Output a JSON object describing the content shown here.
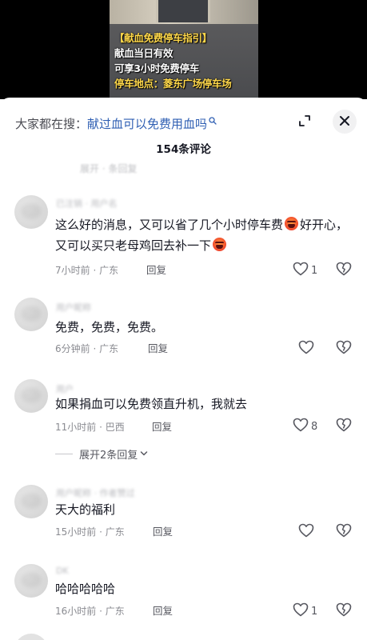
{
  "video": {
    "caption_lines": [
      "【献血免费停车指引】",
      "献血当日有效",
      "可享3小时免费停车",
      "停车地点：菱东广场停车场"
    ]
  },
  "sheet": {
    "search_prefix": "大家都在搜：",
    "search_term": "献过血可以免费用血吗",
    "comment_count": "154条评论",
    "icons": {
      "search": "search-icon",
      "expand": "expand-icon",
      "close": "close-icon",
      "like": "heart-icon",
      "dislike": "broken-heart-icon",
      "chevron": "chevron-down-icon"
    }
  },
  "ghost_reply": "展开 · 条回复",
  "comments": [
    {
      "username": "已注销 · 用户名",
      "text_parts": [
        "这么好的消息，又可以省了几个小时停车费",
        "好开心，又可以买只老母鸡回去补一下",
        ""
      ],
      "time": "7小时前 · 广东",
      "reply": "回复",
      "likes": "1"
    },
    {
      "username": "用户昵称",
      "text_parts": [
        "免费，免费，免费。"
      ],
      "time": "6分钟前 · 广东",
      "reply": "回复",
      "likes": ""
    },
    {
      "username": "用户",
      "text_parts": [
        "如果捐血可以免费领直升机，我就去"
      ],
      "time": "11小时前 · 巴西",
      "reply": "回复",
      "likes": "8",
      "expand_replies": "展开2条回复"
    },
    {
      "username": "用户昵称 · 作者赞过",
      "text_parts": [
        "天大的福利"
      ],
      "time": "15小时前 · 广东",
      "reply": "回复",
      "likes": ""
    },
    {
      "username": "DK",
      "text_parts": [
        "哈哈哈哈哈"
      ],
      "time": "16小时前 · 广东",
      "reply": "回复",
      "likes": "1"
    }
  ],
  "colors": {
    "search_term": "#2f5fb3",
    "caption_highlight": "#ffd84a",
    "meta_text": "#8a8b91"
  }
}
